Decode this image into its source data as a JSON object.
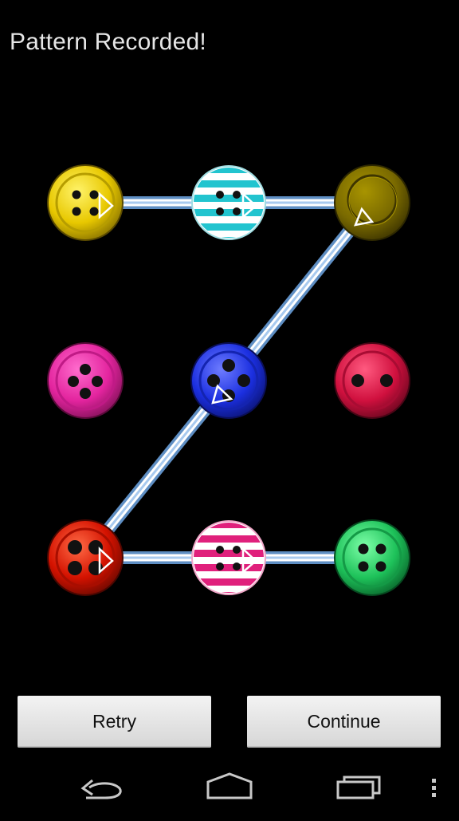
{
  "header": {
    "status": "Pattern Recorded!"
  },
  "pattern": {
    "grid": 3,
    "dots": [
      {
        "name": "dot-1",
        "style": "yellow-four-hole"
      },
      {
        "name": "dot-2",
        "style": "cyan-striped"
      },
      {
        "name": "dot-3",
        "style": "olive-ring"
      },
      {
        "name": "dot-4",
        "style": "pink-four-hole"
      },
      {
        "name": "dot-5",
        "style": "blue-four-hole"
      },
      {
        "name": "dot-6",
        "style": "crimson-two-hole"
      },
      {
        "name": "dot-7",
        "style": "red-four-hole"
      },
      {
        "name": "dot-8",
        "style": "magenta-striped"
      },
      {
        "name": "dot-9",
        "style": "green-four-hole"
      }
    ],
    "selected_sequence": [
      1,
      2,
      3,
      5,
      7,
      8,
      9
    ],
    "colors": {
      "yellow": "#e8c800",
      "cyan": "#22c4cf",
      "olive": "#7a6a00",
      "pink": "#e3249e",
      "blue": "#1b2fe0",
      "crimson": "#d0103e",
      "red": "#d41200",
      "magenta": "#e0207c",
      "green": "#1ec25a",
      "line": "#ffffff",
      "line_glow": "#6fa7e6"
    }
  },
  "actions": {
    "retry": "Retry",
    "continue": "Continue"
  },
  "navbar": {
    "icons": [
      "back-icon",
      "home-icon",
      "recent-apps-icon",
      "overflow-menu-icon"
    ]
  }
}
